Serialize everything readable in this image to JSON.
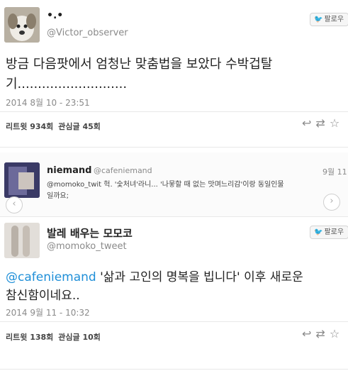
{
  "tweet1": {
    "display_name": "•.•",
    "handle": "@Victor_observer",
    "follow_label": "팔로우",
    "text_line1": "방금 다음팟에서 엄청난 맞춤법을 보았다 수박겁탈",
    "text_line2": "기...........................",
    "timestamp": "2014 8월 10 - 23:51",
    "retweet_count": "리트윗 934회",
    "favorite_count": "관심글 45회",
    "action_reply_icon": "reply-icon",
    "action_retweet_icon": "retweet-icon"
  },
  "tweet2": {
    "display_name": "niemand",
    "handle": "@cafeniemand",
    "date": "9월 11",
    "text_line1": "@momoko_twit 헉. '숯처녀'라니... '나뭏할 때 없는 맛며느리감'이랑 동일인물",
    "text_line2": "일까요;"
  },
  "tweet3": {
    "display_name": "발레 배우는 모모코",
    "handle": "@momoko_tweet",
    "follow_label": "팔로우",
    "mention": "@cafeniemand",
    "text_line1_rest": " '삶과 고인의 명복을 빕니다' 이후 새로운",
    "text_line2": "참신함이네요..",
    "timestamp": "2014 9월 11 - 10:32",
    "retweet_count": "리트윗 138회",
    "favorite_count": "관심글 10회"
  },
  "colors": {
    "link": "#1f8fd8",
    "bird": "#2aa3ef"
  }
}
